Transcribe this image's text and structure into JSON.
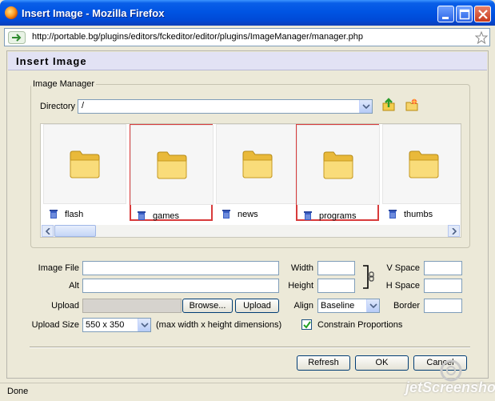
{
  "window": {
    "title": "Insert Image - Mozilla Firefox"
  },
  "address_bar": {
    "url": "http://portable.bg/plugins/editors/fckeditor/editor/plugins/ImageManager/manager.php"
  },
  "dialog": {
    "title": "Insert Image",
    "image_manager": {
      "legend": "Image Manager",
      "directory_label": "Directory",
      "directory_value": "/",
      "folders": [
        {
          "name": "flash",
          "selected": false
        },
        {
          "name": "games",
          "selected": true
        },
        {
          "name": "news",
          "selected": false
        },
        {
          "name": "programs",
          "selected": true
        },
        {
          "name": "thumbs",
          "selected": false
        }
      ]
    },
    "form": {
      "image_file_label": "Image File",
      "alt_label": "Alt",
      "upload_label": "Upload",
      "browse_label": "Browse...",
      "upload_button_label": "Upload",
      "upload_size_label": "Upload Size",
      "upload_size_value": "550 x 350",
      "upload_size_hint": "(max width x height dimensions)",
      "width_label": "Width",
      "height_label": "Height",
      "align_label": "Align",
      "align_value": "Baseline",
      "vspace_label": "V Space",
      "hspace_label": "H Space",
      "border_label": "Border",
      "constrain_label": "Constrain Proportions",
      "constrain_checked": true
    },
    "buttons": {
      "refresh": "Refresh",
      "ok": "OK",
      "cancel": "Cancel"
    }
  },
  "status_bar": {
    "text": "Done"
  },
  "watermark": {
    "text": "jetScreenshot"
  },
  "colors": {
    "titlebar": "#0054e3",
    "dialog_bg": "#ece9d8",
    "header_bg": "#e2e2f4",
    "selection_border": "#d83b3b",
    "folder_yellow": "#f6d46b"
  },
  "icons": [
    "firefox-icon",
    "minimize-icon",
    "maximize-icon",
    "close-icon",
    "site-identity-icon",
    "bookmark-star-icon",
    "folder-up-icon",
    "new-folder-icon",
    "folder-icon",
    "trash-icon",
    "chain-link-icon",
    "checkmark-icon",
    "chevron-down-icon"
  ]
}
